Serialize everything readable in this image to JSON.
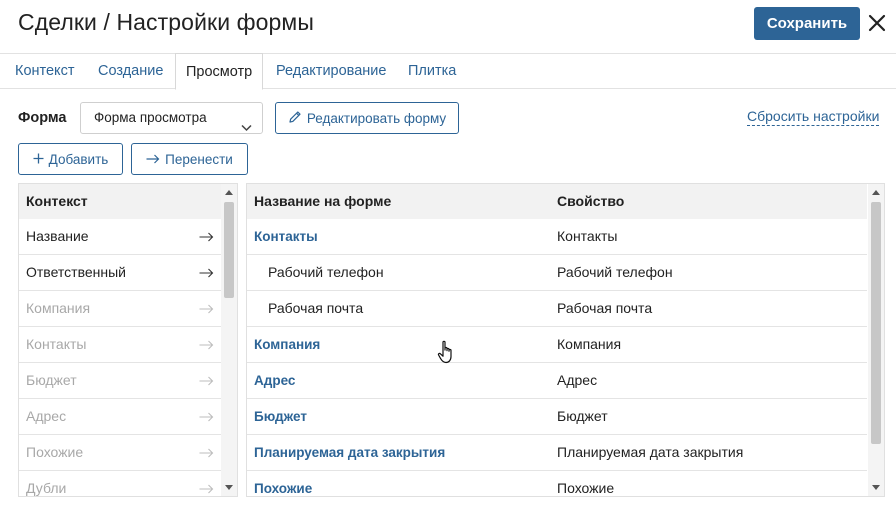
{
  "header": {
    "title": "Сделки / Настройки формы",
    "save_label": "Сохранить",
    "close_icon": "close-icon"
  },
  "tabs": [
    {
      "label": "Контекст",
      "active": false
    },
    {
      "label": "Создание",
      "active": false
    },
    {
      "label": "Просмотр",
      "active": true
    },
    {
      "label": "Редактирование",
      "active": false
    },
    {
      "label": "Плитка",
      "active": false
    }
  ],
  "toolbar": {
    "form_label": "Форма",
    "form_select_value": "Форма просмотра",
    "edit_form_label": "Редактировать форму",
    "reset_label": "Сбросить настройки",
    "add_label": "Добавить",
    "move_label": "Перенести"
  },
  "context_panel": {
    "header": "Контекст",
    "items": [
      {
        "label": "Название",
        "enabled": true
      },
      {
        "label": "Ответственный",
        "enabled": true
      },
      {
        "label": "Компания",
        "enabled": false
      },
      {
        "label": "Контакты",
        "enabled": false
      },
      {
        "label": "Бюджет",
        "enabled": false
      },
      {
        "label": "Адрес",
        "enabled": false
      },
      {
        "label": "Похожие",
        "enabled": false
      },
      {
        "label": "Дубли",
        "enabled": false
      }
    ]
  },
  "form_panel": {
    "col_name": "Название на форме",
    "col_property": "Свойство",
    "rows": [
      {
        "name": "Контакты",
        "property": "Контакты",
        "kind": "link"
      },
      {
        "name": "Рабочий телефон",
        "property": "Рабочий телефон",
        "kind": "child"
      },
      {
        "name": "Рабочая почта",
        "property": "Рабочая почта",
        "kind": "child"
      },
      {
        "name": "Компания",
        "property": "Компания",
        "kind": "link"
      },
      {
        "name": "Адрес",
        "property": "Адрес",
        "kind": "link"
      },
      {
        "name": "Бюджет",
        "property": "Бюджет",
        "kind": "link"
      },
      {
        "name": "Планируемая дата закрытия",
        "property": "Планируемая дата закрытия",
        "kind": "link"
      },
      {
        "name": "Похожие",
        "property": "Похожие",
        "kind": "link"
      }
    ]
  },
  "colors": {
    "accent": "#2d6496",
    "text": "#222222",
    "muted": "#a8a8a8",
    "header_bg": "#f2f2f2"
  }
}
